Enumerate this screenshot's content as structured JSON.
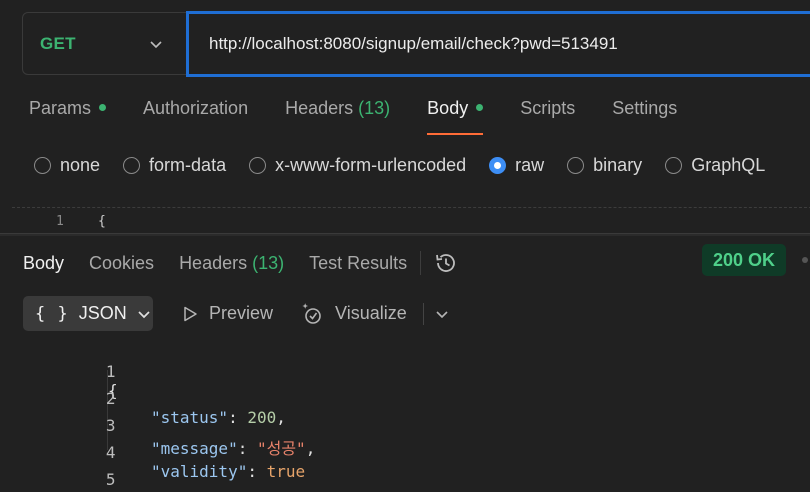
{
  "request": {
    "method": "GET",
    "url": "http://localhost:8080/signup/email/check?pwd=513491"
  },
  "request_tabs": [
    {
      "label": "Params",
      "dot": true
    },
    {
      "label": "Authorization"
    },
    {
      "label": "Headers",
      "count": "(13)"
    },
    {
      "label": "Body",
      "dot": true,
      "active": true
    },
    {
      "label": "Scripts"
    },
    {
      "label": "Settings"
    }
  ],
  "body_types": [
    {
      "label": "none"
    },
    {
      "label": "form-data"
    },
    {
      "label": "x-www-form-urlencoded"
    },
    {
      "label": "raw",
      "selected": true
    },
    {
      "label": "binary"
    },
    {
      "label": "GraphQL"
    }
  ],
  "request_editor": {
    "line": "1",
    "code": "{"
  },
  "response_tabs": [
    {
      "label": "Body",
      "active": true
    },
    {
      "label": "Cookies"
    },
    {
      "label": "Headers",
      "count": "(13)"
    },
    {
      "label": "Test Results"
    }
  ],
  "status": {
    "text": "200 OK",
    "color": "#4fd08a"
  },
  "toolbar": {
    "format_braces": "{ }",
    "format_label": "JSON",
    "preview_label": "Preview",
    "visualize_label": "Visualize"
  },
  "response_json": {
    "line_numbers": [
      "1",
      "2",
      "3",
      "4",
      "5"
    ],
    "open_brace": "{",
    "close_brace": "}",
    "status_key": "\"status\"",
    "status_value": "200",
    "message_key": "\"message\"",
    "message_value": "\"성공\"",
    "validity_key": "\"validity\"",
    "validity_value": "true"
  },
  "colors": {
    "accent": "#ff6c37",
    "url_border": "#1f6ed4",
    "method": "#3cb371"
  }
}
